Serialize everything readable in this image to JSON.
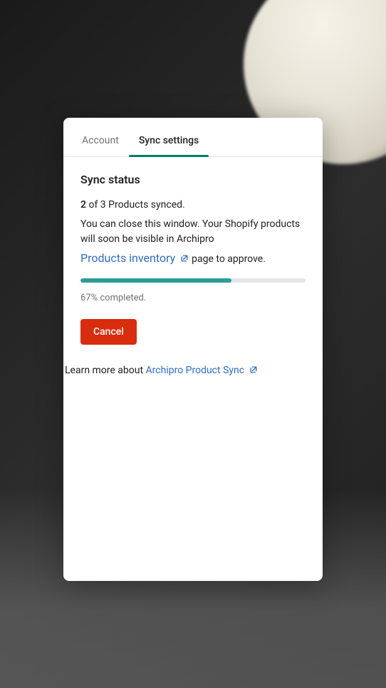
{
  "tabs": {
    "account": "Account",
    "sync_settings": "Sync settings"
  },
  "section_title": "Sync status",
  "sync": {
    "synced_count": "2",
    "of_text": " of 3 Products synced.",
    "close_window_text": "You can close this window. Your Shopify products will soon be visible in Archipro",
    "inventory_link_text": "Products inventory",
    "inventory_after_text": " page to approve.",
    "progress_percent": 67,
    "progress_label": "67% completed."
  },
  "buttons": {
    "cancel": "Cancel"
  },
  "learn_more": {
    "prefix": "Learn more about ",
    "link_text": "Archipro Product Sync"
  },
  "colors": {
    "accent": "#008060",
    "link": "#2c6ecb",
    "danger": "#d82c0d",
    "progress": "#2c9c99"
  }
}
